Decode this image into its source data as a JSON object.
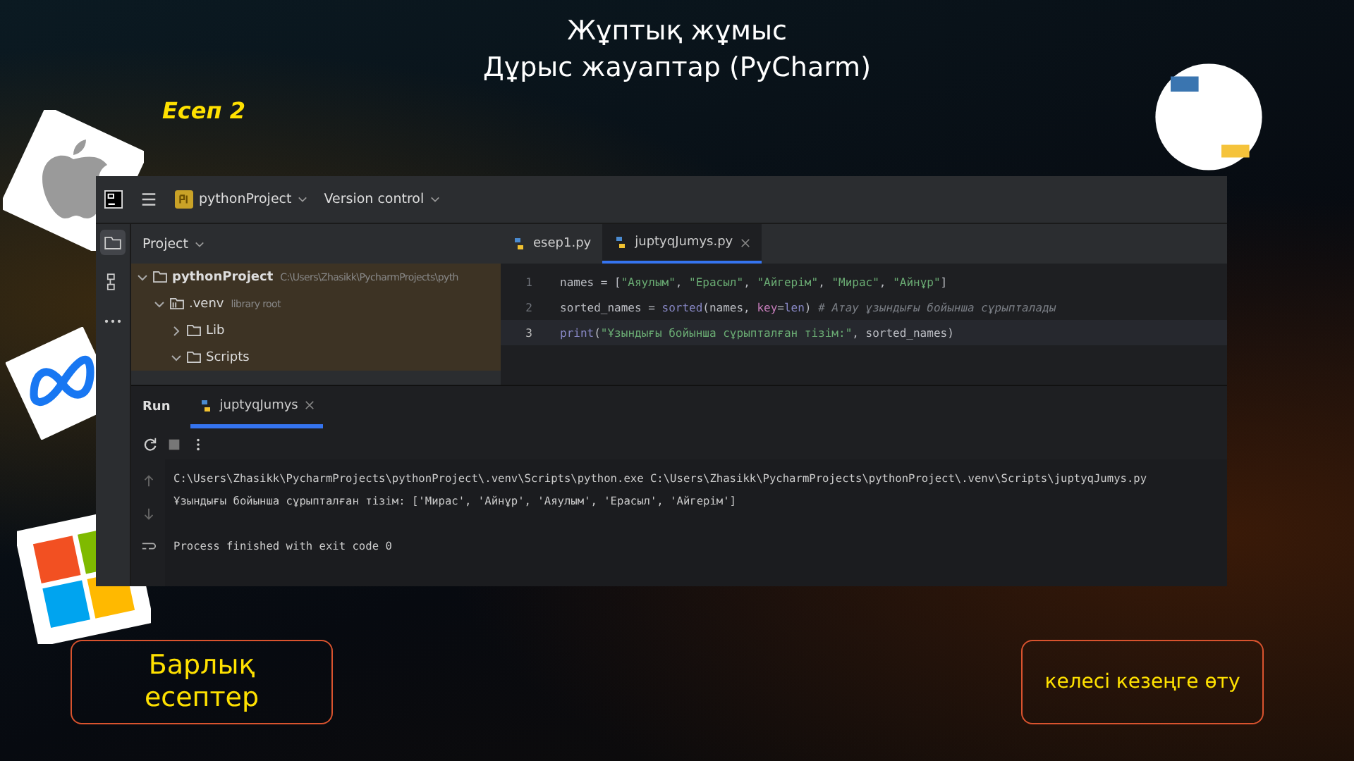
{
  "slide": {
    "title_lines": [
      "Жұптық жұмыс",
      "Дұрыс жауаптар (PyCharm)"
    ],
    "task_label": "Есеп 2"
  },
  "ide": {
    "toolbar": {
      "project": "pythonProject",
      "vcs": "Version control"
    },
    "tool_strip": [
      {
        "kind": "folder",
        "selected": true
      },
      {
        "kind": "structure",
        "selected": false
      },
      {
        "kind": "more",
        "selected": false
      }
    ],
    "project_panel": {
      "title": "Project",
      "tree": [
        {
          "label": "pythonProject",
          "hint": "C:\\Users\\Zhasikk\\PycharmProjects\\pyth",
          "expanded": true,
          "kind": "folder",
          "children": [
            {
              "label": ".venv",
              "hint": "library root",
              "expanded": true,
              "kind": "venv",
              "children": [
                {
                  "label": "Lib",
                  "expanded": false,
                  "kind": "folder"
                },
                {
                  "label": "Scripts",
                  "expanded": true,
                  "kind": "folder"
                }
              ]
            }
          ]
        }
      ]
    },
    "editor_tabs": [
      {
        "label": "esep1.py",
        "selected": false,
        "closable": false
      },
      {
        "label": "juptyqJumys.py",
        "selected": true,
        "closable": true
      }
    ],
    "code": [
      {
        "number": "1",
        "current": false,
        "tokens": [
          {
            "kind": "plain",
            "text": "names = ["
          },
          {
            "kind": "string",
            "text": "\"Аяулым\""
          },
          {
            "kind": "plain",
            "text": ", "
          },
          {
            "kind": "string",
            "text": "\"Ерасыл\""
          },
          {
            "kind": "plain",
            "text": ", "
          },
          {
            "kind": "string",
            "text": "\"Айгерім\""
          },
          {
            "kind": "plain",
            "text": ", "
          },
          {
            "kind": "string",
            "text": "\"Мирас\""
          },
          {
            "kind": "plain",
            "text": ", "
          },
          {
            "kind": "string",
            "text": "\"Айнұр\""
          },
          {
            "kind": "plain",
            "text": "]"
          }
        ]
      },
      {
        "number": "2",
        "current": false,
        "tokens": [
          {
            "kind": "plain",
            "text": "sorted_names = "
          },
          {
            "kind": "builtin",
            "text": "sorted"
          },
          {
            "kind": "plain",
            "text": "(names, "
          },
          {
            "kind": "param",
            "text": "key"
          },
          {
            "kind": "plain",
            "text": "="
          },
          {
            "kind": "builtin",
            "text": "len"
          },
          {
            "kind": "plain",
            "text": ")  "
          },
          {
            "kind": "comment",
            "text": "# Атау ұзындығы бойынша сұрыпталады"
          }
        ]
      },
      {
        "number": "3",
        "current": true,
        "tokens": [
          {
            "kind": "builtin",
            "text": "print"
          },
          {
            "kind": "plain",
            "text": "("
          },
          {
            "kind": "string",
            "text": "\"Ұзындығы бойынша сұрыпталған тізім:\""
          },
          {
            "kind": "plain",
            "text": ", sorted_names)"
          }
        ]
      }
    ],
    "run_panel": {
      "title": "Run",
      "tabs": [
        {
          "label": "juptyqJumys",
          "selected": true
        }
      ],
      "console": [
        {
          "kind": "command",
          "text": "C:\\Users\\Zhasikk\\PycharmProjects\\pythonProject\\.venv\\Scripts\\python.exe C:\\Users\\Zhasikk\\PycharmProjects\\pythonProject\\.venv\\Scripts\\juptyqJumys.py"
        },
        {
          "kind": "output",
          "text": "Ұзындығы бойынша сұрыпталған тізім: ['Мирас', 'Айнұр', 'Аяулым', 'Ерасыл', 'Айгерім']"
        },
        {
          "kind": "status",
          "text": "Process finished with exit code 0"
        }
      ]
    }
  },
  "buttons": [
    {
      "label": "Барлық есептер"
    },
    {
      "label": "келесі кезеңге өту"
    }
  ]
}
